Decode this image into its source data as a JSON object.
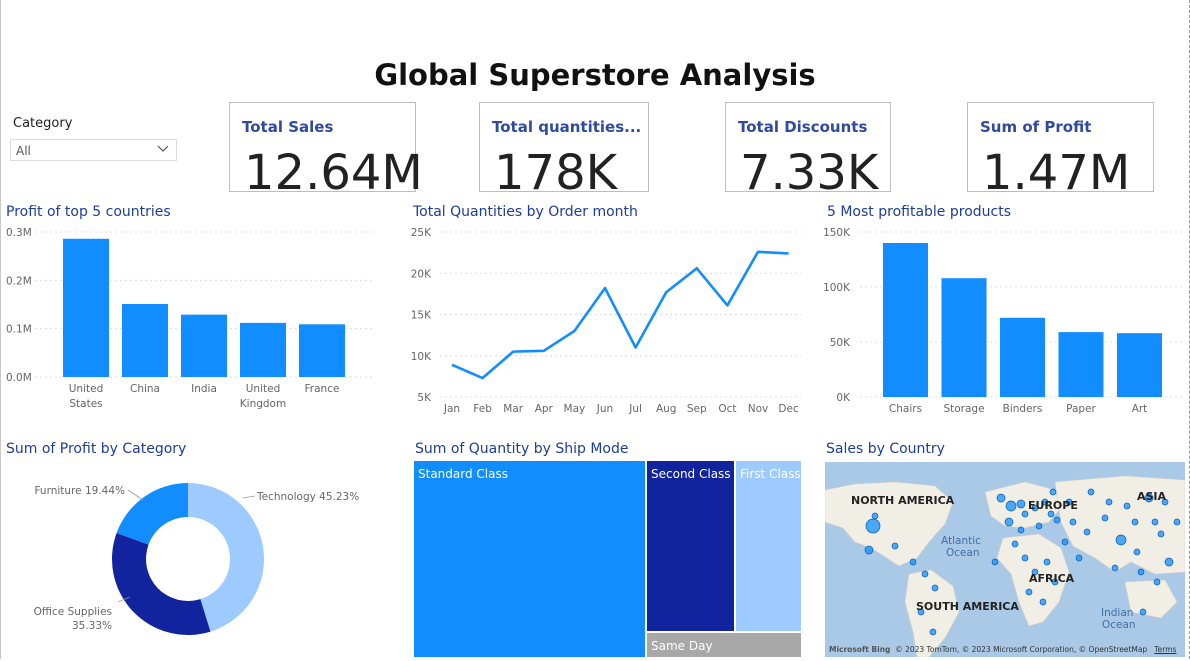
{
  "report": {
    "title": "Global Superstore Analysis"
  },
  "slicer": {
    "label": "Category",
    "value": "All"
  },
  "cards": [
    {
      "label": "Total Sales",
      "value": "12.64M"
    },
    {
      "label": "Total quantities...",
      "value": "178K"
    },
    {
      "label": "Total Discounts",
      "value": "7.33K"
    },
    {
      "label": "Sum of Profit",
      "value": "1.47M"
    }
  ],
  "visual_titles": {
    "profit_countries": "Profit of top 5 countries",
    "quantities_month": "Total Quantities by Order month",
    "profitable_products": "5 Most profitable products",
    "profit_category": "Sum of Profit by Category",
    "quantity_shipmode": "Sum of Quantity by Ship Mode",
    "sales_country": "Sales by Country"
  },
  "colors": {
    "primary": "#118dff",
    "dark": "#12239e",
    "light": "#9ecbff",
    "gray": "#a8a8a8",
    "title": "#1c3d9a"
  },
  "chart_data": [
    {
      "type": "bar",
      "title": "Profit of top 5 countries",
      "categories": [
        "United States",
        "China",
        "India",
        "United Kingdom",
        "France"
      ],
      "category_lines": [
        [
          "United",
          "States"
        ],
        [
          "China"
        ],
        [
          "India"
        ],
        [
          "United",
          "Kingdom"
        ],
        [
          "France"
        ]
      ],
      "values": [
        286000,
        151000,
        129000,
        112000,
        109000
      ],
      "yticks": [
        "0.0M",
        "0.1M",
        "0.2M",
        "0.3M"
      ],
      "ylim": [
        0,
        300000
      ],
      "grid": true
    },
    {
      "type": "line",
      "title": "Total Quantities by Order month",
      "categories": [
        "Jan",
        "Feb",
        "Mar",
        "Apr",
        "May",
        "Jun",
        "Jul",
        "Aug",
        "Sep",
        "Oct",
        "Nov",
        "Dec"
      ],
      "values": [
        8900,
        7300,
        10500,
        10600,
        13000,
        18200,
        11000,
        17700,
        20600,
        16100,
        22600,
        22400
      ],
      "yticks": [
        "5K",
        "10K",
        "15K",
        "20K",
        "25K"
      ],
      "ylim": [
        5000,
        25000
      ],
      "grid": true
    },
    {
      "type": "bar",
      "title": "5 Most profitable products",
      "categories": [
        "Chairs",
        "Storage",
        "Binders",
        "Paper",
        "Art"
      ],
      "values": [
        140000,
        108000,
        72000,
        59000,
        58000
      ],
      "yticks": [
        "0K",
        "50K",
        "100K",
        "150K"
      ],
      "ylim": [
        0,
        150000
      ],
      "grid": true
    },
    {
      "type": "pie",
      "title": "Sum of Profit by Category",
      "slices": [
        {
          "label": "Technology",
          "pct_text": "45.23%",
          "value": 45.23
        },
        {
          "label": "Office Supplies",
          "pct_text": "35.33%",
          "value": 35.33
        },
        {
          "label": "Furniture",
          "pct_text": "19.44%",
          "value": 19.44
        }
      ]
    },
    {
      "type": "heatmap",
      "title": "Sum of Quantity by Ship Mode",
      "items": [
        {
          "label": "Standard Class",
          "share": 0.6
        },
        {
          "label": "Second Class",
          "share": 0.2
        },
        {
          "label": "First Class",
          "share": 0.16
        },
        {
          "label": "Same Day",
          "share": 0.04
        }
      ]
    }
  ],
  "map": {
    "title": "Sales by Country",
    "labels": [
      "NORTH AMERICA",
      "EUROPE",
      "ASIA",
      "AFRICA",
      "SOUTH AMERICA"
    ],
    "oceans": [
      [
        "Atlantic",
        "Ocean"
      ],
      [
        "Indian",
        "Ocean"
      ]
    ],
    "attribution": "© 2023 TomTom, © 2023 Microsoft Corporation, © OpenStreetMap",
    "terms": "Terms",
    "logo": "Microsoft Bing"
  }
}
